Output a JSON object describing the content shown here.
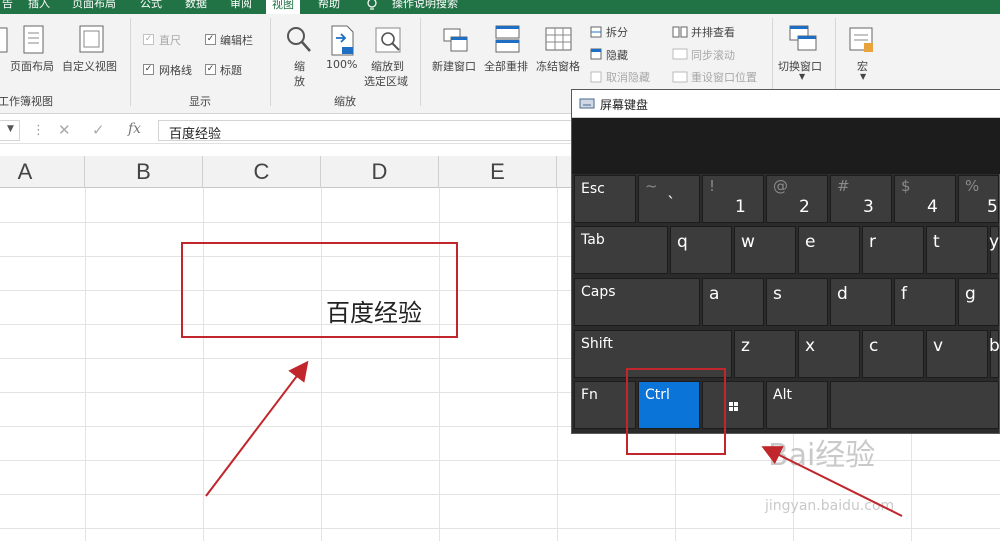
{
  "ribbon_tabs": [
    "告",
    "插入",
    "页面布局",
    "公式",
    "数据",
    "审阅",
    "视图",
    "帮助",
    "操作说明搜索"
  ],
  "ribbon": {
    "workbook_views": {
      "page_layout": "页面布局",
      "custom_views": "自定义视图",
      "group_label": "工作簿视图"
    },
    "show": {
      "ruler": "直尺",
      "formula_bar": "编辑栏",
      "gridlines": "网格线",
      "headings": "标题",
      "group_label": "显示"
    },
    "zoom": {
      "zoom_line1": "缩",
      "zoom_line2": "放",
      "hundred": "100%",
      "selection_line1": "缩放到",
      "selection_line2": "选定区域",
      "group_label": "缩放"
    },
    "window": {
      "new_window": "新建窗口",
      "arrange_all": "全部重排",
      "freeze_panes": "冻结窗格",
      "split": "拆分",
      "hide": "隐藏",
      "unhide": "取消隐藏",
      "side_by_side": "并排查看",
      "sync_scroll": "同步滚动",
      "reset_position": "重设窗口位置",
      "switch_windows": "切换窗口",
      "macros": "宏"
    }
  },
  "formula_bar": {
    "fx": "fx",
    "content": "百度经验"
  },
  "columns": [
    "A",
    "B",
    "C",
    "D",
    "E"
  ],
  "cell_text": "百度经验",
  "osk": {
    "title": "屏幕键盘",
    "row1": [
      {
        "label": "Esc"
      },
      {
        "shift": "~",
        "main": "`"
      },
      {
        "shift": "!",
        "main": "1"
      },
      {
        "shift": "@",
        "main": "2"
      },
      {
        "shift": "#",
        "main": "3"
      },
      {
        "shift": "$",
        "main": "4"
      },
      {
        "shift": "%",
        "main": "5"
      }
    ],
    "row2": [
      "Tab",
      "q",
      "w",
      "e",
      "r",
      "t",
      "y"
    ],
    "row3": [
      "Caps",
      "a",
      "s",
      "d",
      "f",
      "g"
    ],
    "row4": [
      "Shift",
      "z",
      "x",
      "c",
      "v",
      "b"
    ],
    "row5": [
      "Fn",
      "Ctrl",
      "Alt"
    ]
  },
  "watermark": {
    "line1": "Bai经验",
    "line2": "jingyan.baidu.com"
  },
  "colors": {
    "excel_green": "#217346",
    "highlight_red": "#c0262b",
    "ctrl_blue": "#0a74d9"
  }
}
